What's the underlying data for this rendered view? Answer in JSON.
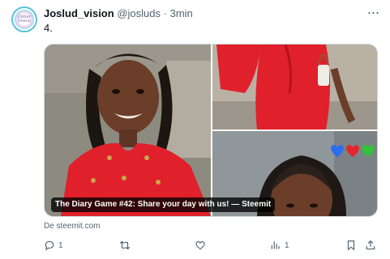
{
  "tweet": {
    "display_name": "Joslud_vision",
    "handle": "@josluds",
    "separator": "·",
    "time": "3min",
    "text": "4.",
    "avatar_text": "Glitter Vision"
  },
  "card": {
    "caption": "The Diary Game #42: Share your day with us! — Steemit",
    "source": "De steemit.com"
  },
  "actions": {
    "reply_count": "1",
    "retweet_count": "",
    "like_count": "",
    "views_count": "1"
  },
  "colors": {
    "text_primary": "#0f1419",
    "text_secondary": "#536471",
    "border": "#cfd9de",
    "dress_red": "#e0202b"
  },
  "icons": [
    "more-icon",
    "reply-icon",
    "retweet-icon",
    "like-icon",
    "views-icon",
    "bookmark-icon",
    "share-icon"
  ]
}
